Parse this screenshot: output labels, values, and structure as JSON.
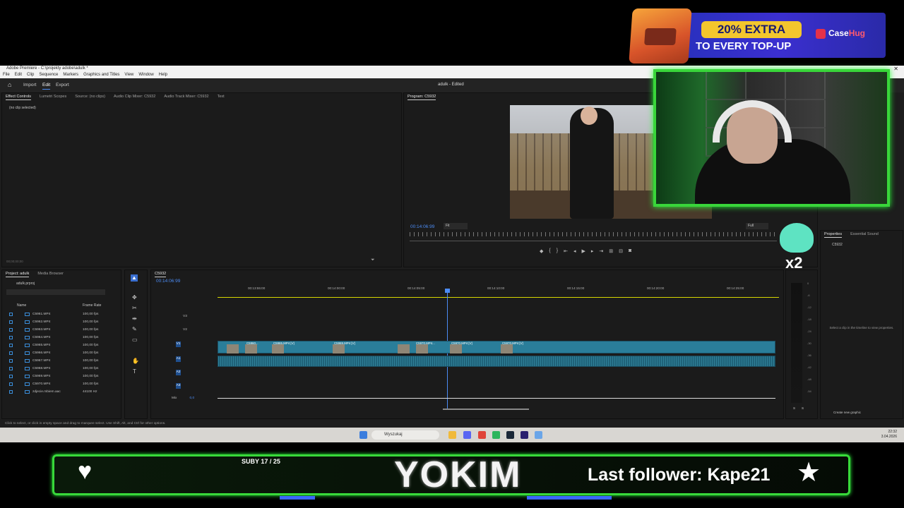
{
  "ad": {
    "pill": "20% EXTRA",
    "line2": "TO EVERY TOP-UP",
    "brand_a": "Case",
    "brand_b": "Hug"
  },
  "window": {
    "title": "Adobe Premiere - C:\\projekty adobe\\adulk *",
    "menu": [
      "File",
      "Edit",
      "Clip",
      "Sequence",
      "Markers",
      "Graphics and Titles",
      "View",
      "Window",
      "Help"
    ],
    "workspaces": {
      "import": "Import",
      "edit": "Edit",
      "export": "Export"
    },
    "doc_title": "adulk - Edited"
  },
  "effect_panel": {
    "tabs": [
      "Effect Controls",
      "Lumetri Scopes",
      "Source: (no clips)",
      "Audio Clip Mixer: C5932",
      "Audio Track Mixer: C5932",
      "Text"
    ],
    "empty": "(no clip selected)",
    "timecode": "00;00;00;00"
  },
  "program": {
    "tab": "Program: C5932",
    "timecode": "00:14:06:99",
    "fit": "Fit",
    "quality": "Full"
  },
  "project": {
    "tabs": [
      "Project: adulk",
      "Media Browser"
    ],
    "file": "adulk.prproj",
    "col_name": "Name",
    "col_rate": "Frame Rate",
    "files": [
      {
        "name": "C5961.MP4",
        "rate": "100,00 fps"
      },
      {
        "name": "C5962.MP4",
        "rate": "100,00 fps"
      },
      {
        "name": "C5963.MP4",
        "rate": "100,00 fps"
      },
      {
        "name": "C5964.MP4",
        "rate": "100,00 fps"
      },
      {
        "name": "C5965.MP4",
        "rate": "100,00 fps"
      },
      {
        "name": "C5966.MP4",
        "rate": "100,00 fps"
      },
      {
        "name": "C5967.MP4",
        "rate": "100,00 fps"
      },
      {
        "name": "C5968.MP4",
        "rate": "100,00 fps"
      },
      {
        "name": "C5969.MP4",
        "rate": "100,00 fps"
      },
      {
        "name": "C5970.MP4",
        "rate": "100,00 fps"
      },
      {
        "name": "zdjecie.mbiem.aac",
        "rate": "44100 Hz"
      }
    ]
  },
  "timeline": {
    "tab": "C5932",
    "timecode": "00:14:06:99",
    "ruler": [
      "00:13:55:00",
      "00:14:00:00",
      "00:14:05:00",
      "00:14:10:00",
      "00:14:15:00",
      "00:14:20:00",
      "00:14:25:00"
    ],
    "tracks": {
      "v3": "V3",
      "v2": "V2",
      "v1": "V1",
      "a1": "A1",
      "a2": "A2",
      "a3": "A3",
      "mix": "Mix",
      "mix_val": "0,0"
    },
    "clips": [
      "C5960...",
      "C5965.MP4 [V]",
      "C5969.MP4 [V]",
      "C5970.MP4...",
      "C5970.MP4 [V]",
      "C5970.MP4 [V]"
    ]
  },
  "meter": {
    "scale": [
      "0",
      "-6",
      "-12",
      "-18",
      "-24",
      "-30",
      "-36",
      "-42",
      "-48",
      "-54"
    ],
    "s1": "S",
    "s2": "S"
  },
  "properties": {
    "tabs": [
      "Properties",
      "Essential Sound"
    ],
    "item": "C5932",
    "hint": "Select a clip in the timeline to view properties.",
    "button": "Create new graphic"
  },
  "status": "Click to select, or click in empty space and drag to marquee select. Use Shift, Alt, and Ctrl for other options.",
  "taskbar": {
    "search": "Wyszukaj",
    "time": "22:32",
    "date": "3.04.2026"
  },
  "mascot": {
    "label": "x2"
  },
  "overlay": {
    "subs": "SUBY 17 / 25",
    "name": "YOKIM",
    "follower": "Last follower: Kape21"
  }
}
